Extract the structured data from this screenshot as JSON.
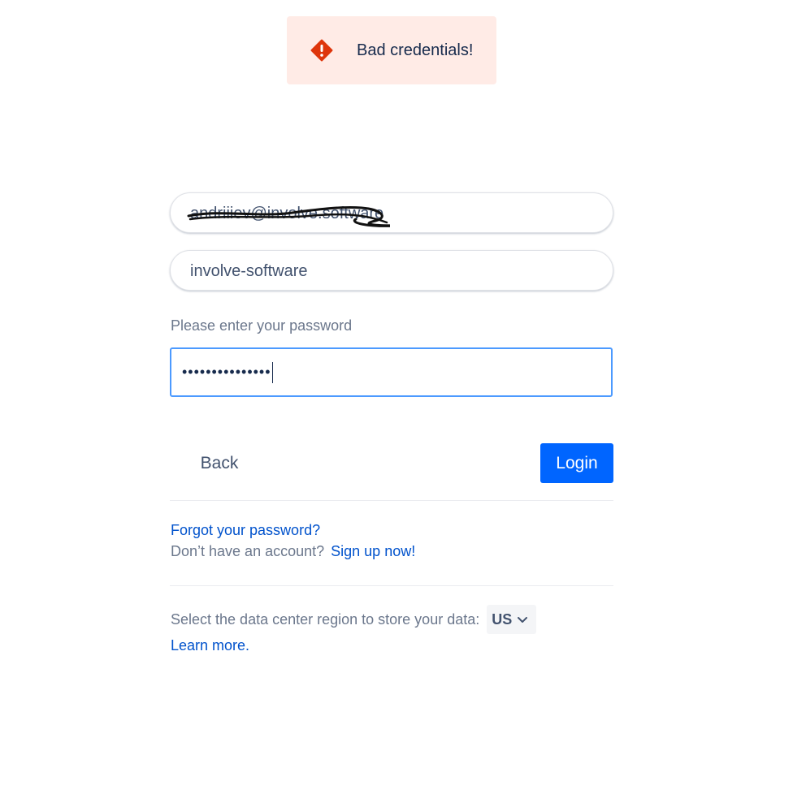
{
  "banner": {
    "message": "Bad credentials!",
    "icon": "error-icon",
    "background_color": "#ffebe6",
    "icon_color": "#de350b"
  },
  "email_field": {
    "value": "andriiiev@involve.software",
    "icon": "redaction-scribble"
  },
  "site_field": {
    "value": "involve-software"
  },
  "password": {
    "label": "Please enter your password",
    "masked_value": "•••••••••••••••",
    "focus_color": "#4c9aff"
  },
  "actions": {
    "back_label": "Back",
    "login_label": "Login",
    "login_color": "#0065ff"
  },
  "links": {
    "forgot_password": "Forgot your password?",
    "no_account_text": "Don’t have an account?",
    "sign_up": "Sign up now!",
    "learn_more": "Learn more."
  },
  "region": {
    "prompt": "Select the data center region to store your data:",
    "selected": "US",
    "icon": "chevron-down-icon"
  }
}
